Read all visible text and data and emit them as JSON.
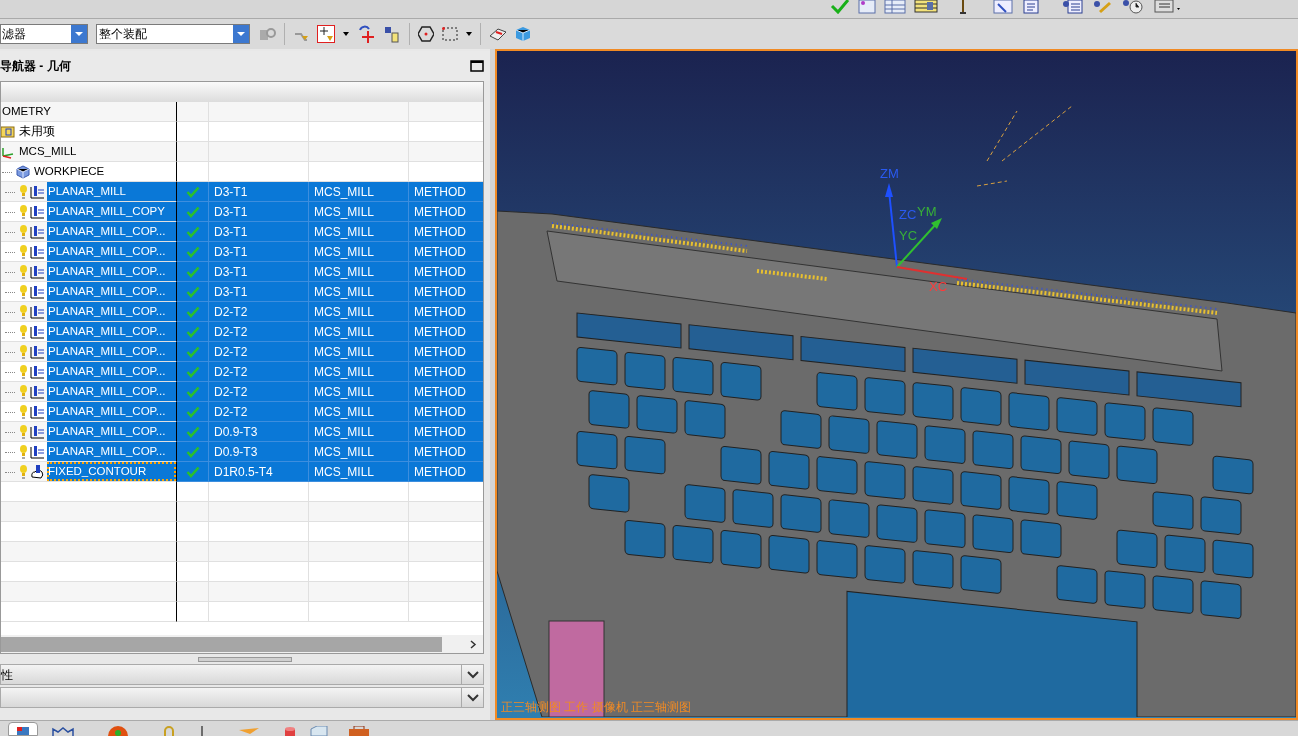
{
  "toolbar": {
    "filter_dropdown": {
      "value": "滤器"
    },
    "scope_dropdown": {
      "value": "整个装配"
    }
  },
  "navigator": {
    "title": "导航器 - 几何",
    "tree": [
      {
        "name": "OMETRY",
        "selected": false,
        "children": [
          {
            "name": "未用项",
            "kind": "folder",
            "selected": false
          },
          {
            "name": "MCS_MILL",
            "kind": "mcs",
            "selected": false,
            "children": [
              {
                "name": "WORKPIECE",
                "kind": "workpiece",
                "selected": false,
                "children": [
                  {
                    "name": "PLANAR_MILL",
                    "kind": "planar_mill",
                    "selected": true,
                    "focused": false,
                    "complete": true,
                    "tool": "D3-T1",
                    "geometry": "MCS_MILL",
                    "method": "METHOD"
                  },
                  {
                    "name": "PLANAR_MILL_COPY",
                    "kind": "planar_mill",
                    "selected": true,
                    "focused": false,
                    "complete": true,
                    "tool": "D3-T1",
                    "geometry": "MCS_MILL",
                    "method": "METHOD"
                  },
                  {
                    "name": "PLANAR_MILL_COP...",
                    "kind": "planar_mill",
                    "selected": true,
                    "focused": false,
                    "complete": true,
                    "tool": "D3-T1",
                    "geometry": "MCS_MILL",
                    "method": "METHOD"
                  },
                  {
                    "name": "PLANAR_MILL_COP...",
                    "kind": "planar_mill",
                    "selected": true,
                    "focused": false,
                    "complete": true,
                    "tool": "D3-T1",
                    "geometry": "MCS_MILL",
                    "method": "METHOD"
                  },
                  {
                    "name": "PLANAR_MILL_COP...",
                    "kind": "planar_mill",
                    "selected": true,
                    "focused": false,
                    "complete": true,
                    "tool": "D3-T1",
                    "geometry": "MCS_MILL",
                    "method": "METHOD"
                  },
                  {
                    "name": "PLANAR_MILL_COP...",
                    "kind": "planar_mill",
                    "selected": true,
                    "focused": false,
                    "complete": true,
                    "tool": "D3-T1",
                    "geometry": "MCS_MILL",
                    "method": "METHOD"
                  },
                  {
                    "name": "PLANAR_MILL_COP...",
                    "kind": "planar_mill",
                    "selected": true,
                    "focused": false,
                    "complete": true,
                    "tool": "D2-T2",
                    "geometry": "MCS_MILL",
                    "method": "METHOD"
                  },
                  {
                    "name": "PLANAR_MILL_COP...",
                    "kind": "planar_mill",
                    "selected": true,
                    "focused": false,
                    "complete": true,
                    "tool": "D2-T2",
                    "geometry": "MCS_MILL",
                    "method": "METHOD"
                  },
                  {
                    "name": "PLANAR_MILL_COP...",
                    "kind": "planar_mill",
                    "selected": true,
                    "focused": false,
                    "complete": true,
                    "tool": "D2-T2",
                    "geometry": "MCS_MILL",
                    "method": "METHOD"
                  },
                  {
                    "name": "PLANAR_MILL_COP...",
                    "kind": "planar_mill",
                    "selected": true,
                    "focused": false,
                    "complete": true,
                    "tool": "D2-T2",
                    "geometry": "MCS_MILL",
                    "method": "METHOD"
                  },
                  {
                    "name": "PLANAR_MILL_COP...",
                    "kind": "planar_mill",
                    "selected": true,
                    "focused": false,
                    "complete": true,
                    "tool": "D2-T2",
                    "geometry": "MCS_MILL",
                    "method": "METHOD"
                  },
                  {
                    "name": "PLANAR_MILL_COP...",
                    "kind": "planar_mill",
                    "selected": true,
                    "focused": false,
                    "complete": true,
                    "tool": "D2-T2",
                    "geometry": "MCS_MILL",
                    "method": "METHOD"
                  },
                  {
                    "name": "PLANAR_MILL_COP...",
                    "kind": "planar_mill",
                    "selected": true,
                    "focused": false,
                    "complete": true,
                    "tool": "D0.9-T3",
                    "geometry": "MCS_MILL",
                    "method": "METHOD"
                  },
                  {
                    "name": "PLANAR_MILL_COP...",
                    "kind": "planar_mill",
                    "selected": true,
                    "focused": false,
                    "complete": true,
                    "tool": "D0.9-T3",
                    "geometry": "MCS_MILL",
                    "method": "METHOD"
                  },
                  {
                    "name": "FIXED_CONTOUR",
                    "kind": "fixed_contour",
                    "selected": true,
                    "focused": true,
                    "complete": true,
                    "tool": "D1R0.5-T4",
                    "geometry": "MCS_MILL",
                    "method": "METHOD"
                  }
                ]
              }
            ]
          }
        ]
      }
    ]
  },
  "sections": [
    {
      "label": "性",
      "expanded": false
    },
    {
      "expanded": false
    }
  ],
  "viewport": {
    "axes": [
      "ZM",
      "ZC",
      "YM",
      "YC",
      "XC"
    ],
    "view_label": "正三轴测图 工作 摄像机 正三轴测图"
  }
}
